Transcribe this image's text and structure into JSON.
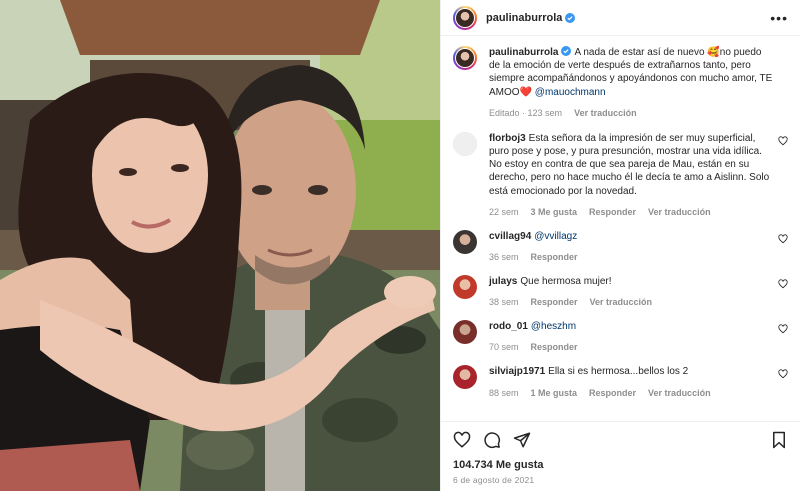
{
  "header": {
    "username": "paulinaburrola",
    "more_label": "•••"
  },
  "caption": {
    "username": "paulinaburrola",
    "text": "A nada de estar así de nuevo 🥰no puedo de la emoción de verte después de extrañarnos tanto, pero siempre acompañándonos y apoyándonos con mucho amor, TE AMOO❤️ ",
    "mention": "@mauochmann",
    "edited": "Editado",
    "sep": " · ",
    "time": "123 sem",
    "translate": "Ver traducción"
  },
  "comments": [
    {
      "username": "florboj3",
      "text": "Esta señora da la impresión de ser muy superficial, puro pose y pose, y pura presunción, mostrar una vida idílica. No estoy en contra de que sea pareja de Mau, están en su derecho, pero no hace mucho él le decía te amo a Aislinn. Solo está emocionado por la novedad.",
      "mention": "",
      "time": "22 sem",
      "likes": "3 Me gusta",
      "reply": "Responder",
      "translate": "Ver traducción"
    },
    {
      "username": "cvillag94",
      "text": "",
      "mention": "@vvillagz",
      "time": "36 sem",
      "likes": "",
      "reply": "Responder",
      "translate": ""
    },
    {
      "username": "julays",
      "text": "Que hermosa mujer!",
      "mention": "",
      "time": "38 sem",
      "likes": "",
      "reply": "Responder",
      "translate": "Ver traducción"
    },
    {
      "username": "rodo_01",
      "text": "",
      "mention": "@heszhm",
      "time": "70 sem",
      "likes": "",
      "reply": "Responder",
      "translate": ""
    },
    {
      "username": "silviajp1971",
      "text": "Ella si es hermosa...bellos los 2",
      "mention": "",
      "time": "88 sem",
      "likes": "1 Me gusta",
      "reply": "Responder",
      "translate": "Ver traducción"
    }
  ],
  "footer": {
    "likes": "104.734 Me gusta",
    "date": "6 de agosto de 2021"
  },
  "icons": {
    "like": "heart-icon",
    "comment": "comment-icon",
    "share": "paper-plane-icon",
    "save": "bookmark-icon",
    "verified": "verified-badge-icon"
  },
  "colors": {
    "verified": "#3897f0",
    "link": "#00376b",
    "muted": "#8e8e8e"
  }
}
